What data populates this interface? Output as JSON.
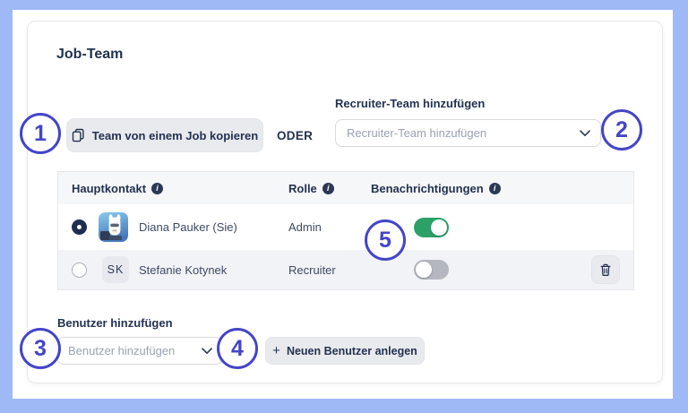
{
  "page": {
    "title": "Job-Team"
  },
  "actions": {
    "copy_team_label": "Team von einem Job kopieren",
    "or_label": "ODER",
    "create_user_label": "Neuen Benutzer anlegen",
    "create_user_plus": "+"
  },
  "recruiter_select": {
    "label": "Recruiter-Team hinzufügen",
    "placeholder": "Recruiter-Team hinzufügen"
  },
  "add_user": {
    "label": "Benutzer hinzufügen",
    "placeholder": "Benutzer hinzufügen"
  },
  "table": {
    "headers": [
      {
        "label": "Hauptkontakt",
        "has_info": true
      },
      {
        "label": "Rolle",
        "has_info": true
      },
      {
        "label": "Benachrichtigungen",
        "has_info": true
      }
    ],
    "rows": [
      {
        "selected": true,
        "avatar": "llama-illustration",
        "name": "Diana Pauker (Sie)",
        "role": "Admin",
        "notifications_on": true,
        "deletable": false
      },
      {
        "selected": false,
        "initials": "SK",
        "name": "Stefanie Kotynek",
        "role": "Recruiter",
        "notifications_on": false,
        "deletable": true
      }
    ]
  },
  "callouts": [
    "1",
    "2",
    "3",
    "4",
    "5"
  ],
  "icons": {
    "info": "i",
    "copy": "copy-icon",
    "chevron": "chevron-down-icon",
    "trash": "trash-icon",
    "plus": "plus-icon"
  },
  "colors": {
    "frame_blue": "#9fb8f6",
    "callout_indigo": "#4445c7",
    "toggle_on_green": "#2ba168",
    "toggle_off_gray": "#b4b6c0",
    "navy_text": "#233250",
    "placeholder_gray": "#9aa2af",
    "header_row_bg": "#f6f7f9",
    "alt_row_bg": "#f2f3f6",
    "button_gray_bg": "#e9eaee"
  }
}
